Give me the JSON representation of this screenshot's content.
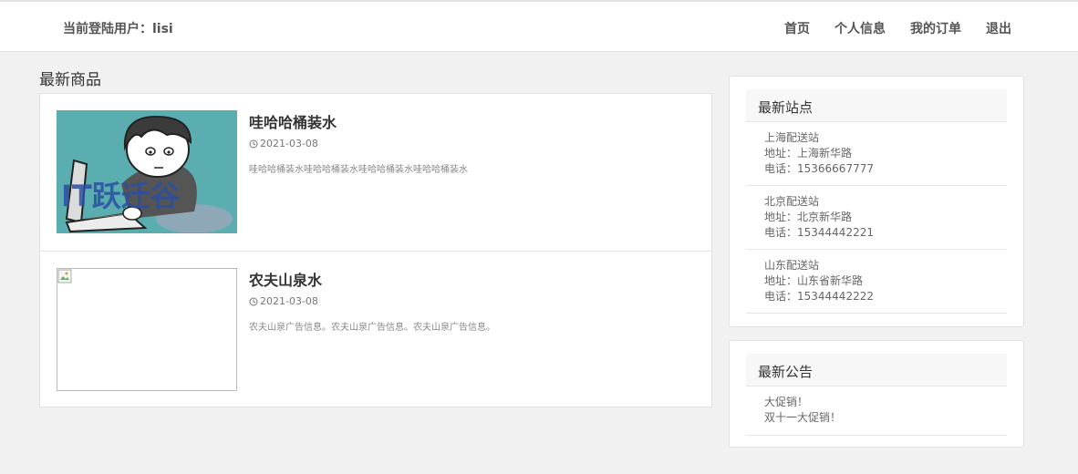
{
  "header": {
    "user_label": "当前登陆用户：lisi",
    "nav": [
      "首页",
      "个人信息",
      "我的订单",
      "退出"
    ]
  },
  "main": {
    "section_title": "最新商品",
    "products": [
      {
        "title": "哇哈哈桶装水",
        "date": "2021-03-08",
        "desc": "哇哈哈桶装水哇哈哈桶装水哇哈哈桶装水哇哈哈桶装水",
        "image_text": "IT跃迁谷"
      },
      {
        "title": "农夫山泉水",
        "date": "2021-03-08",
        "desc": "农夫山泉广告信息。农夫山泉广告信息。农夫山泉广告信息。"
      }
    ]
  },
  "sidebar": {
    "stations_title": "最新站点",
    "stations": [
      {
        "name": "上海配送站",
        "address": "地址：上海新华路",
        "phone": "电话：15366667777"
      },
      {
        "name": "北京配送站",
        "address": "地址：北京新华路",
        "phone": "电话：15344442221"
      },
      {
        "name": "山东配送站",
        "address": "地址：山东省新华路",
        "phone": "电话：15344442222"
      }
    ],
    "notices_title": "最新公告",
    "notices": [
      "大促销！",
      "双十一大促销！"
    ]
  },
  "colors": {
    "image_bg": "#5aaeb0",
    "watermark": "#2b4fa3"
  }
}
